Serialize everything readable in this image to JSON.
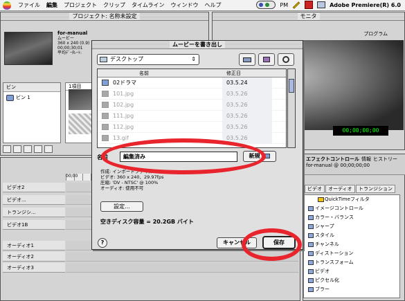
{
  "menubar": {
    "items": [
      "ファイル",
      "編集",
      "プロジェクト",
      "クリップ",
      "タイムライン",
      "ウィンドウ",
      "ヘルプ"
    ],
    "bold_index": 1,
    "status_pm": "PM",
    "app_name": "Adobe Premiere(R) 6.0"
  },
  "project_window": {
    "title": "プロジェクト: 名称未設定",
    "preview_name": "for-manual",
    "preview_info": [
      "ムービー",
      "360 x 240 (0.9)",
      "00;00;30;01",
      "平均ﾃﾞｰﾀﾚｰﾄ:"
    ],
    "bins_header": "ビン",
    "bin_item": "ビン 1",
    "grid_header": "1項目"
  },
  "monitor_window": {
    "title": "モニタ",
    "program_label": "プログラム",
    "timecode": "00;00;00;00"
  },
  "timeline_window": {
    "ruler_label": "00;00",
    "tracks": [
      "ビデオ2",
      "ビデオ...",
      "トランジシ...",
      "ビデオ1B",
      "オーディオ1",
      "オーディオ2",
      "オーディオ3"
    ]
  },
  "effects_window": {
    "tabs_top": [
      "エフェクトコントロール",
      "情報",
      "ヒストリー"
    ],
    "target": "for-manual @ 00;00;00;00",
    "tabs": [
      "ビデオ",
      "オーディオ",
      "トランジション"
    ],
    "items": [
      "QuickTimeフィルタ",
      "イメージコントロール",
      "カラー・バランス",
      "シャープ",
      "スタイル",
      "チャンネル",
      "ディストーション",
      "トランスフォーム",
      "ビデオ",
      "ピクセル化",
      "ブラー"
    ]
  },
  "dialog": {
    "title": "ムービーを書き出し",
    "folder": "デスクトップ",
    "column_name": "名前",
    "column_date": "修正日",
    "files": [
      {
        "name": "02ドラマ",
        "date": "03.5.24",
        "kind": "folder",
        "dim": false
      },
      {
        "name": "101.jpg",
        "date": "03.5.26",
        "kind": "file",
        "dim": true
      },
      {
        "name": "102.jpg",
        "date": "03.5.26",
        "kind": "file",
        "dim": true
      },
      {
        "name": "111.jpg",
        "date": "03.5.26",
        "kind": "file",
        "dim": true
      },
      {
        "name": "112.jpg",
        "date": "03.5.26",
        "kind": "file",
        "dim": true
      },
      {
        "name": "13.gif",
        "date": "03.5.26",
        "kind": "file",
        "dim": true
      }
    ],
    "name_label": "名前",
    "name_value": "編集済み",
    "new_folder": "新規",
    "settings_summary": [
      "作成: インポートファイル",
      "ビデオ: 360 x 240、29.97fps",
      "圧縮: 'DV - NTSC' @ 100%",
      "オーディオ: 使用不可"
    ],
    "settings_button": "設定...",
    "disk_space": "空きディスク容量 = 20.2GB バイト",
    "help": "?",
    "cancel": "キャンセル",
    "save": "保存"
  }
}
